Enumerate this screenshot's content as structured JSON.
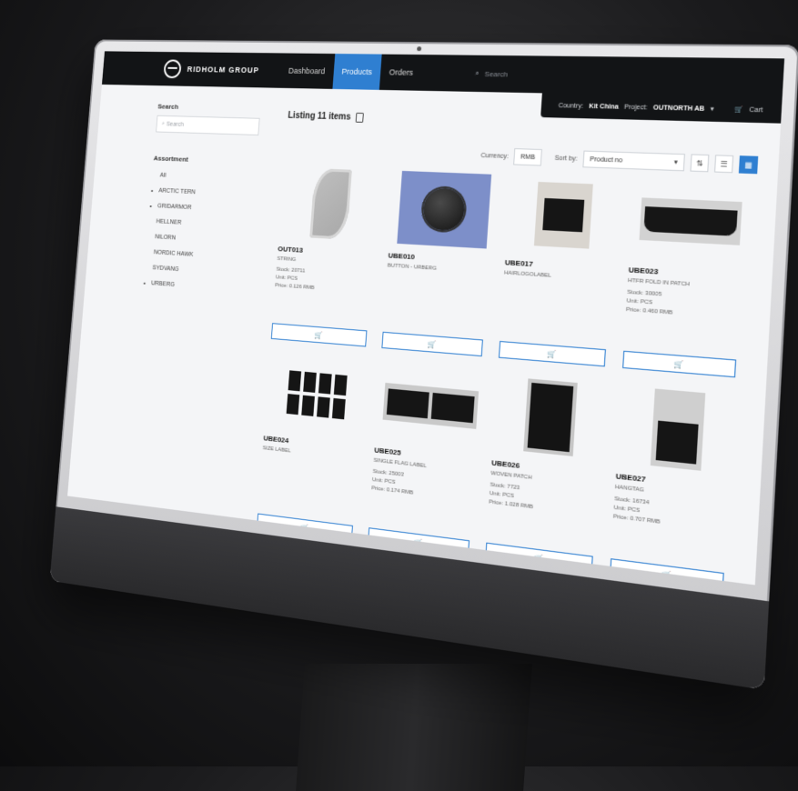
{
  "header": {
    "brand": "RIDHOLM GROUP",
    "nav": [
      {
        "label": "Dashboard",
        "active": false
      },
      {
        "label": "Products",
        "active": true
      },
      {
        "label": "Orders",
        "active": false
      }
    ],
    "search_placeholder": "Search",
    "country_label": "Country:",
    "country_value": "Kit China",
    "project_label": "Project:",
    "project_value": "OUTNORTH AB",
    "cart_label": "Cart"
  },
  "sidebar": {
    "search_title": "Search",
    "search_placeholder": "Search",
    "assortment_title": "Assortment",
    "items": [
      {
        "label": "All",
        "bullet": ""
      },
      {
        "label": "ARCTIC TERN",
        "bullet": "•"
      },
      {
        "label": "GRIDARMOR",
        "bullet": "•"
      },
      {
        "label": "HELLNER",
        "bullet": ""
      },
      {
        "label": "NILORN",
        "bullet": ""
      },
      {
        "label": "NORDIC HAWK",
        "bullet": ""
      },
      {
        "label": "SYDVANG",
        "bullet": ""
      },
      {
        "label": "URBERG",
        "bullet": "•"
      }
    ]
  },
  "main": {
    "listing_title": "Listing 11 items",
    "currency_label": "Currency:",
    "currency_value": "RMB",
    "sort_label": "Sort by:",
    "sort_value": "Product no",
    "products": [
      {
        "code": "OUT013",
        "desc": "STRING",
        "stock": "Stock: 20711",
        "unit": "Unit: PCS",
        "price": "Price: 0.126 RMB",
        "thumb": "leaf"
      },
      {
        "code": "UBE010",
        "desc": "BUTTON - URBERG",
        "stock": "",
        "unit": "",
        "price": "",
        "thumb": "button"
      },
      {
        "code": "UBE017",
        "desc": "HAIRLOGOLABEL",
        "stock": "",
        "unit": "",
        "price": "",
        "thumb": "label"
      },
      {
        "code": "UBE023",
        "desc": "HTFR FOLD IN PATCH",
        "stock": "Stock: 30005",
        "unit": "Unit: PCS",
        "price": "Price: 0.460 RMB",
        "thumb": "strip"
      },
      {
        "code": "UBE024",
        "desc": "SIZE LABEL",
        "stock": "",
        "unit": "",
        "price": "",
        "thumb": "tags"
      },
      {
        "code": "UBE025",
        "desc": "SINGLE FLAG LABEL",
        "stock": "Stock: 25003",
        "unit": "Unit: PCS",
        "price": "Price: 0.174 RMB",
        "thumb": "pair"
      },
      {
        "code": "UBE026",
        "desc": "WOVEN PATCH",
        "stock": "Stock: 7723",
        "unit": "Unit: PCS",
        "price": "Price: 1.028 RMB",
        "thumb": "card"
      },
      {
        "code": "UBE027",
        "desc": "HANGTAG",
        "stock": "Stock: 16734",
        "unit": "Unit: PCS",
        "price": "Price: 0.707 RMB",
        "thumb": "hang"
      }
    ]
  },
  "icons": {
    "cart": "cart-icon",
    "search": "search-icon",
    "add_to_cart": "cart-plus-icon",
    "filter": "filter-icon",
    "list_view": "list-view-icon",
    "grid_view": "grid-view-icon"
  },
  "colors": {
    "accent": "#2f7fd1",
    "topbar": "#121416"
  }
}
